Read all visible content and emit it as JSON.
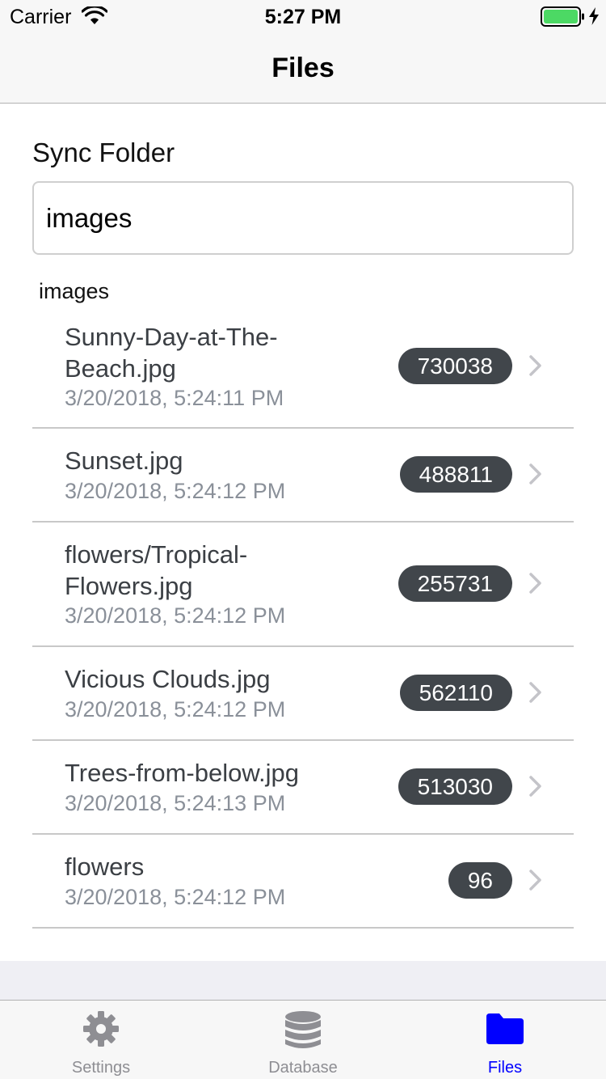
{
  "status_bar": {
    "carrier": "Carrier",
    "time": "5:27 PM",
    "battery_color": "#4cd964"
  },
  "nav": {
    "title": "Files"
  },
  "sync": {
    "label": "Sync Folder",
    "value": "images"
  },
  "section": {
    "header": "images"
  },
  "files": [
    {
      "name": "Sunny-Day-at-The-Beach.jpg",
      "name_lines": [
        "Sunny-Day-at-The-",
        "Beach.jpg"
      ],
      "date": "3/20/2018, 5:24:11 PM",
      "size": "730038"
    },
    {
      "name": "Sunset.jpg",
      "name_lines": [
        "Sunset.jpg"
      ],
      "date": "3/20/2018, 5:24:12 PM",
      "size": "488811"
    },
    {
      "name": "flowers/Tropical-Flowers.jpg",
      "name_lines": [
        "flowers/Tropical-",
        "Flowers.jpg"
      ],
      "date": "3/20/2018, 5:24:12 PM",
      "size": "255731"
    },
    {
      "name": "Vicious Clouds.jpg",
      "name_lines": [
        "Vicious Clouds.jpg"
      ],
      "date": "3/20/2018, 5:24:12 PM",
      "size": "562110"
    },
    {
      "name": "Trees-from-below.jpg",
      "name_lines": [
        "Trees-from-below.jpg"
      ],
      "date": "3/20/2018, 5:24:13 PM",
      "size": "513030"
    },
    {
      "name": "flowers",
      "name_lines": [
        "flowers"
      ],
      "date": "3/20/2018, 5:24:12 PM",
      "size": "96"
    }
  ],
  "tabs": [
    {
      "label": "Settings",
      "icon": "gear-icon",
      "active": false
    },
    {
      "label": "Database",
      "icon": "database-icon",
      "active": false
    },
    {
      "label": "Files",
      "icon": "folder-icon",
      "active": true
    }
  ],
  "colors": {
    "accent": "#0000ff",
    "badge": "#41464b",
    "inactive_tab": "#8e8e93"
  }
}
